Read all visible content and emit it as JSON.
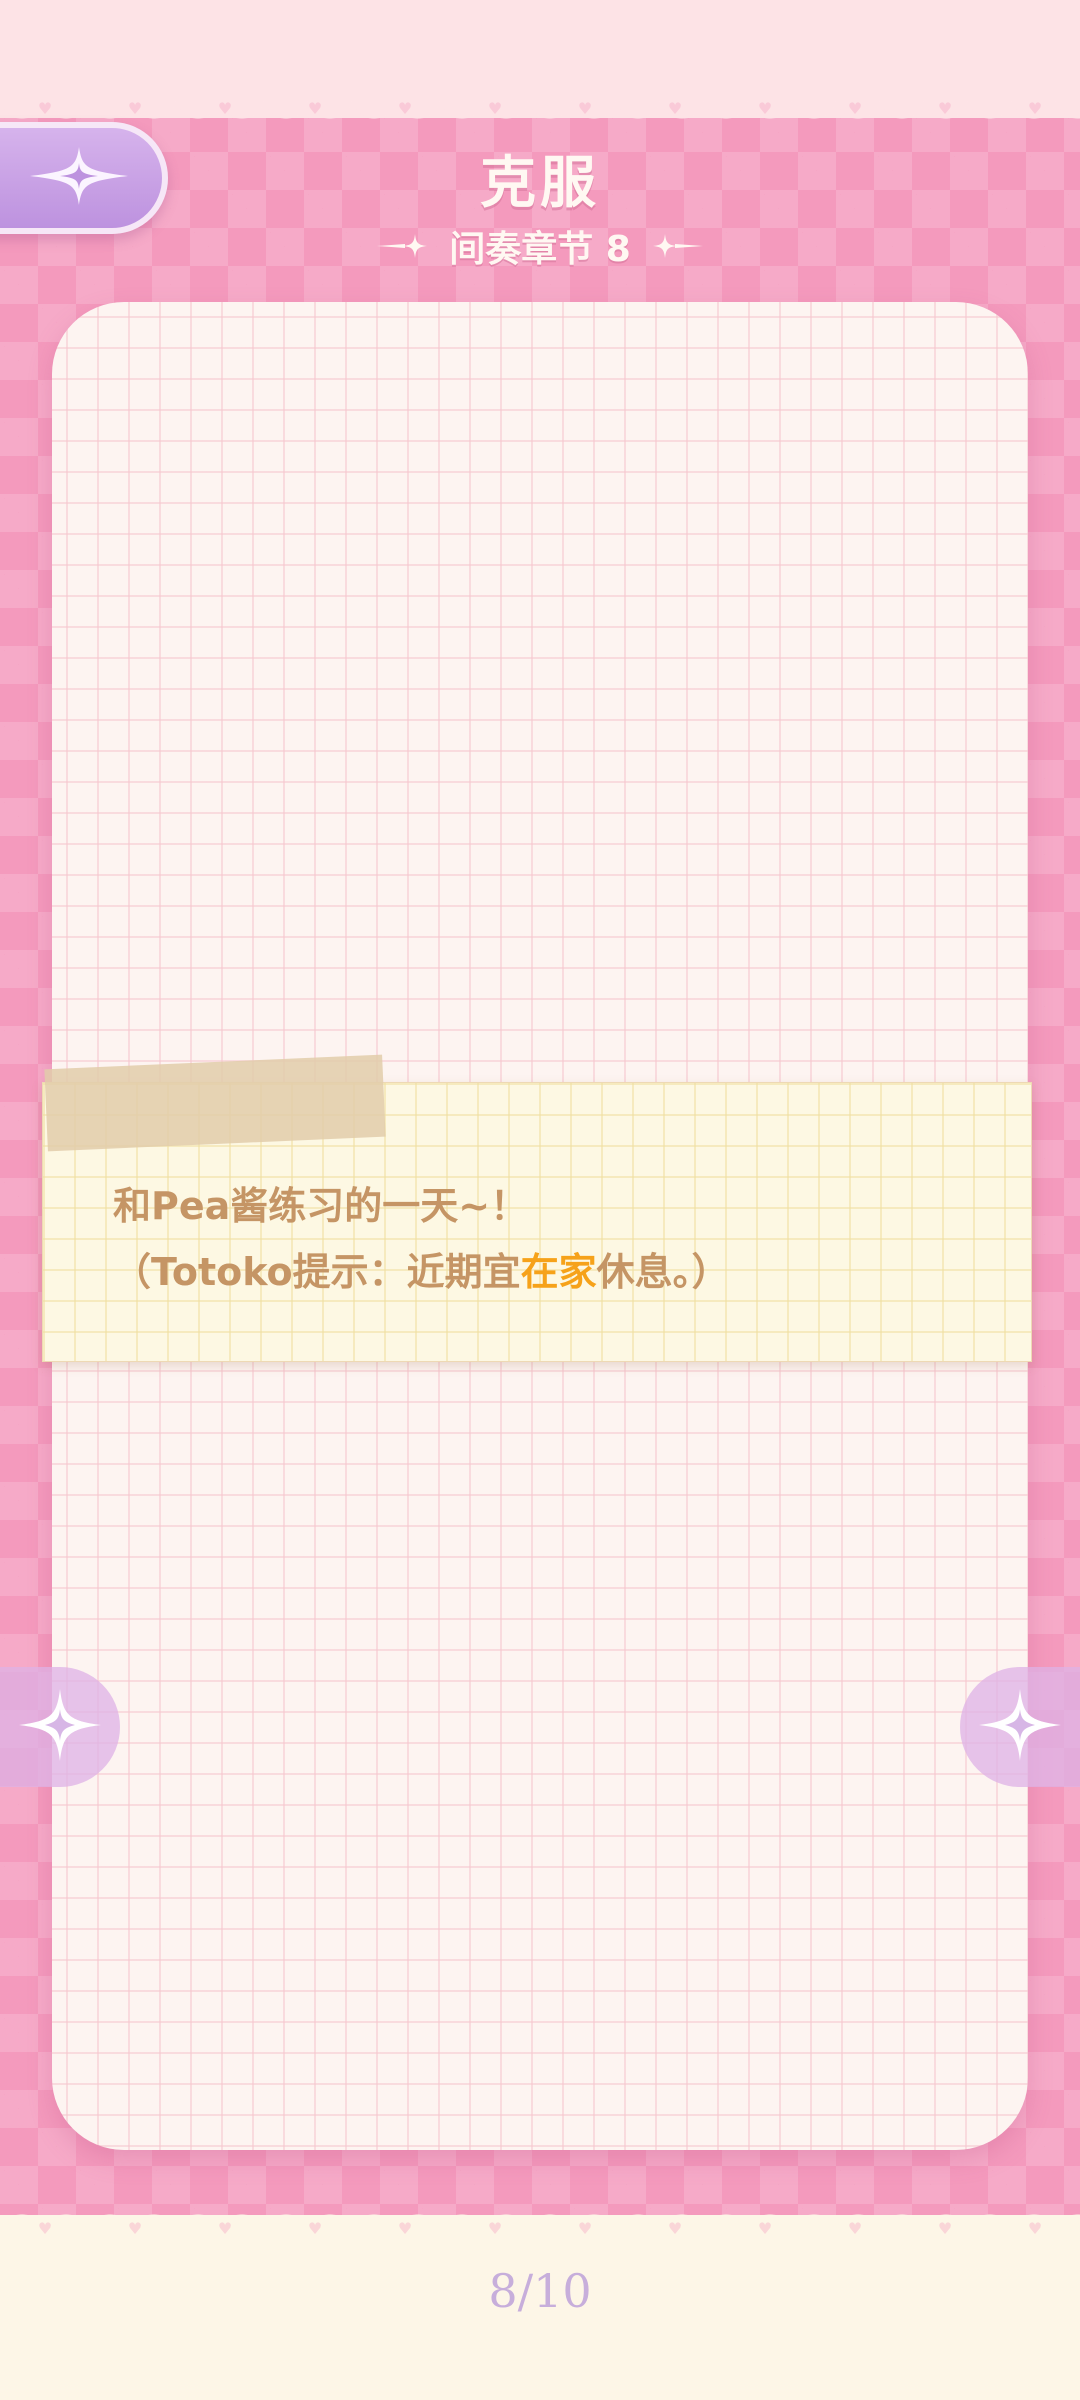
{
  "header": {
    "title": "克服",
    "subtitle": "间奏章节 8",
    "back_icon": "four-point-star-icon"
  },
  "note": {
    "line1": "和Pea酱练习的一天~！",
    "line2_prefix": "（Totoko提示：近期宜",
    "line2_highlight": "在家",
    "line2_suffix": "休息。）",
    "highlight_color": "#f6a21a",
    "text_color": "#c59565"
  },
  "navigation": {
    "prev_icon": "four-point-star-icon",
    "next_icon": "four-point-star-icon"
  },
  "pagination": {
    "current": "8",
    "total": "10",
    "label": "8/10"
  },
  "colors": {
    "background": "#f49abd",
    "paper": "#fdf4f1",
    "accent_purple": "#bd92df"
  }
}
